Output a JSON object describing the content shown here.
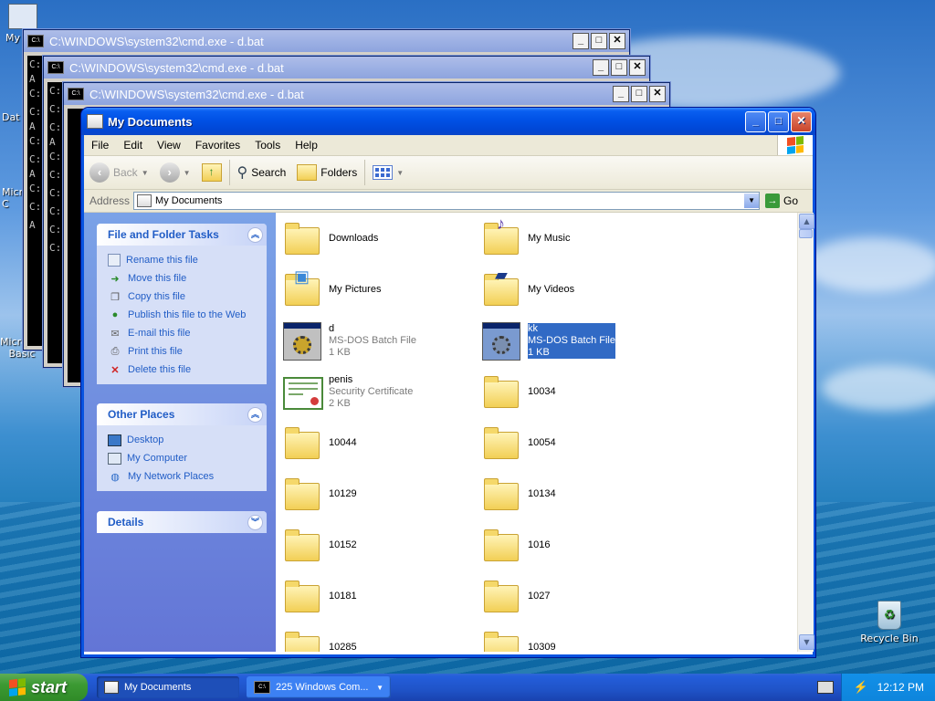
{
  "desktop": {
    "icons": [
      {
        "label": "My"
      },
      {
        "label": "Dat"
      },
      {
        "label": "Micro C"
      },
      {
        "label": "Microsoft Basic"
      },
      {
        "label": "Recycle Bin"
      }
    ],
    "cmd_windows": [
      {
        "title": "C:\\WINDOWS\\system32\\cmd.exe - d.bat",
        "lines": [
          "C:",
          "A",
          "",
          "C:",
          "",
          "C:",
          "A",
          "C:",
          "",
          "C:",
          "A",
          "C:",
          "",
          "C:",
          "A"
        ]
      },
      {
        "title": "C:\\WINDOWS\\system32\\cmd.exe - d.bat",
        "lines": [
          "C:",
          "A",
          "C:",
          "",
          "C:",
          "A",
          "C:",
          "",
          "C:",
          "A",
          "C:",
          "",
          "C:",
          "A",
          "C:",
          "",
          "C:"
        ]
      },
      {
        "title": "C:\\WINDOWS\\system32\\cmd.exe - d.bat",
        "lines": [
          "C:",
          "",
          "C:",
          "",
          "C:",
          "A",
          "C:",
          "",
          "C:",
          "",
          "C:",
          "",
          "C:",
          "",
          "C:"
        ]
      }
    ]
  },
  "explorer": {
    "title": "My Documents",
    "menu": [
      "File",
      "Edit",
      "View",
      "Favorites",
      "Tools",
      "Help"
    ],
    "toolbar": {
      "back": "Back",
      "search": "Search",
      "folders": "Folders"
    },
    "address": {
      "label": "Address",
      "value": "My Documents",
      "go": "Go"
    },
    "tasks": {
      "title": "File and Folder Tasks",
      "items": [
        {
          "label": "Rename this file",
          "icon": "rename-icon"
        },
        {
          "label": "Move this file",
          "icon": "move-icon"
        },
        {
          "label": "Copy this file",
          "icon": "copy-icon"
        },
        {
          "label": "Publish this file to the Web",
          "icon": "publish-web-icon"
        },
        {
          "label": "E-mail this file",
          "icon": "email-icon"
        },
        {
          "label": "Print this file",
          "icon": "print-icon"
        },
        {
          "label": "Delete this file",
          "icon": "delete-icon"
        }
      ]
    },
    "other_places": {
      "title": "Other Places",
      "items": [
        {
          "label": "Desktop",
          "icon": "desktop-icon"
        },
        {
          "label": "My Computer",
          "icon": "my-computer-icon"
        },
        {
          "label": "My Network Places",
          "icon": "network-places-icon"
        }
      ]
    },
    "details": {
      "title": "Details"
    },
    "files": [
      {
        "name": "Downloads",
        "type": "",
        "size": "",
        "icon": "folder"
      },
      {
        "name": "My Music",
        "type": "",
        "size": "",
        "icon": "music-folder"
      },
      {
        "name": "My Pictures",
        "type": "",
        "size": "",
        "icon": "pictures-folder"
      },
      {
        "name": "My Videos",
        "type": "",
        "size": "",
        "icon": "videos-folder"
      },
      {
        "name": "d",
        "type": "MS-DOS Batch File",
        "size": "1 KB",
        "icon": "batch-file"
      },
      {
        "name": "kk",
        "type": "MS-DOS Batch File",
        "size": "1 KB",
        "icon": "batch-file",
        "selected": true
      },
      {
        "name": "penis",
        "type": "Security Certificate",
        "size": "2 KB",
        "icon": "certificate"
      },
      {
        "name": "10034",
        "type": "",
        "size": "",
        "icon": "folder"
      },
      {
        "name": "10044",
        "type": "",
        "size": "",
        "icon": "folder"
      },
      {
        "name": "10054",
        "type": "",
        "size": "",
        "icon": "folder"
      },
      {
        "name": "10129",
        "type": "",
        "size": "",
        "icon": "folder"
      },
      {
        "name": "10134",
        "type": "",
        "size": "",
        "icon": "folder"
      },
      {
        "name": "10152",
        "type": "",
        "size": "",
        "icon": "folder"
      },
      {
        "name": "1016",
        "type": "",
        "size": "",
        "icon": "folder"
      },
      {
        "name": "10181",
        "type": "",
        "size": "",
        "icon": "folder"
      },
      {
        "name": "1027",
        "type": "",
        "size": "",
        "icon": "folder"
      },
      {
        "name": "10285",
        "type": "",
        "size": "",
        "icon": "folder"
      },
      {
        "name": "10309",
        "type": "",
        "size": "",
        "icon": "folder"
      }
    ]
  },
  "taskbar": {
    "start": "start",
    "tasks": [
      {
        "label": "My Documents",
        "active": true
      },
      {
        "label": "225 Windows Com...",
        "active": false
      }
    ],
    "clock": "12:12 PM"
  },
  "colors": {
    "xp_blue": "#0853e0",
    "link_blue": "#215dc6",
    "selection": "#316ac5",
    "start_green": "#3c9a33"
  }
}
